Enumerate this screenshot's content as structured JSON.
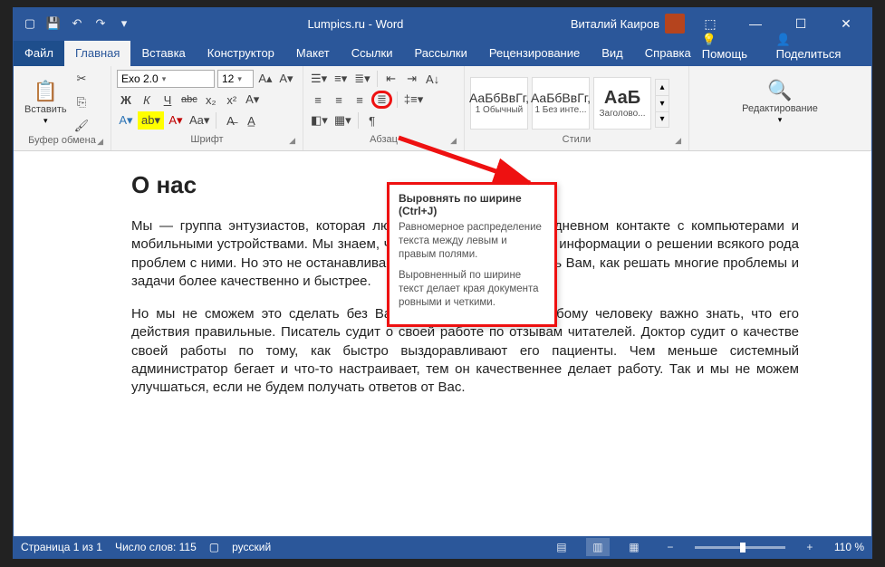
{
  "titlebar": {
    "title": "Lumpics.ru - Word",
    "user": "Виталий Каиров"
  },
  "tabs": {
    "file": "Файл",
    "home": "Главная",
    "insert": "Вставка",
    "design": "Конструктор",
    "layout": "Макет",
    "references": "Ссылки",
    "mailings": "Рассылки",
    "review": "Рецензирование",
    "view": "Вид",
    "help": "Справка",
    "help_btn": "Помощь",
    "share": "Поделиться"
  },
  "ribbon": {
    "clipboard": {
      "label": "Буфер обмена",
      "paste": "Вставить"
    },
    "font": {
      "label": "Шрифт",
      "name": "Exo 2.0",
      "size": "12",
      "bold": "Ж",
      "italic": "К",
      "underline": "Ч",
      "strike": "abc",
      "sub": "x₂",
      "sup": "x²"
    },
    "paragraph": {
      "label": "Абзац"
    },
    "styles": {
      "label": "Стили",
      "sample": "АаБбВвГг,",
      "item1": "1 Обычный",
      "item2": "1 Без инте...",
      "item3_sample": "АаБ",
      "item3": "Заголово..."
    },
    "editing": {
      "label": "Редактирование"
    }
  },
  "tooltip": {
    "title": "Выровнять по ширине (Ctrl+J)",
    "p1": "Равномерное распределение текста между левым и правым полями.",
    "p2": "Выровненный по ширине текст делает края документа ровными и четкими."
  },
  "doc": {
    "heading": "О нас",
    "p1": "Мы — группа энтузиастов, которая любит помогать Вам в ежедневном контакте с компьютерами и мобильными устройствами. Мы знаем, что в интернете уже полно информации о решении всякого рода проблем с ними. Но это не останавливает нас, чтобы рассказывать Вам, как решать многие проблемы и задачи более качественно и быстрее.",
    "p2": "Но мы не сможем это сделать без Вашей обратной связи. Любому человеку важно знать, что его действия правильные. Писатель судит о своей работе по отзывам читателей. Доктор судит о качестве своей работы по тому, как быстро выздоравливают его пациенты. Чем меньше системный администратор бегает и что-то настраивает, тем он качественнее делает работу. Так и мы не можем улучшаться, если не будем получать ответов от Вас."
  },
  "status": {
    "page": "Страница 1 из 1",
    "words": "Число слов: 115",
    "lang": "русский",
    "zoom": "110 %"
  }
}
